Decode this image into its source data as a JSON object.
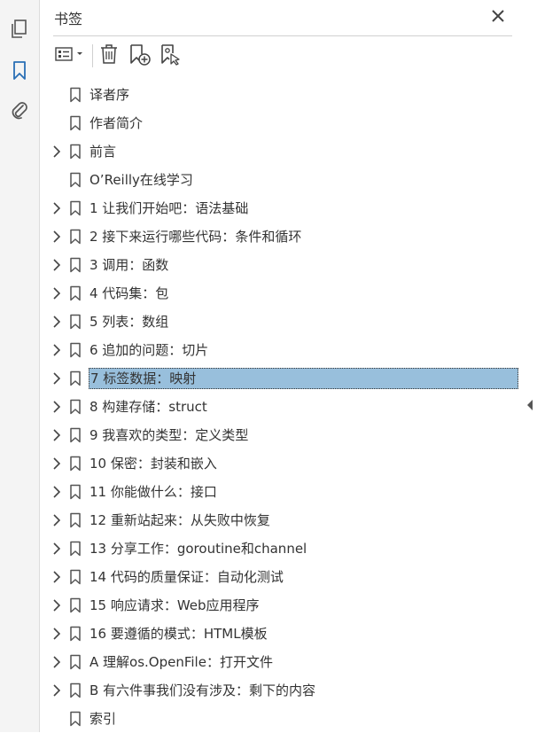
{
  "panel": {
    "title": "书签"
  },
  "rail": {
    "icons": [
      "pages-icon",
      "bookmark-icon",
      "attachment-icon"
    ]
  },
  "toolbar": {
    "icons": [
      "options-menu-icon",
      "delete-icon",
      "new-bookmark-icon",
      "bookmark-from-selection-icon"
    ]
  },
  "bookmarks": [
    {
      "label": "译者序",
      "expandable": false,
      "selected": false
    },
    {
      "label": "作者简介",
      "expandable": false,
      "selected": false
    },
    {
      "label": "前言",
      "expandable": true,
      "selected": false
    },
    {
      "label": "O’Reilly在线学习",
      "expandable": false,
      "selected": false
    },
    {
      "label": "1 让我们开始吧：语法基础",
      "expandable": true,
      "selected": false
    },
    {
      "label": "2 接下来运行哪些代码：条件和循环",
      "expandable": true,
      "selected": false
    },
    {
      "label": "3 调用：函数",
      "expandable": true,
      "selected": false
    },
    {
      "label": "4 代码集：包",
      "expandable": true,
      "selected": false
    },
    {
      "label": "5 列表：数组",
      "expandable": true,
      "selected": false
    },
    {
      "label": "6 追加的问题：切片",
      "expandable": true,
      "selected": false
    },
    {
      "label": "7 标签数据：映射",
      "expandable": true,
      "selected": true
    },
    {
      "label": "8 构建存储：struct",
      "expandable": true,
      "selected": false
    },
    {
      "label": "9 我喜欢的类型：定义类型",
      "expandable": true,
      "selected": false
    },
    {
      "label": "10 保密：封装和嵌入",
      "expandable": true,
      "selected": false
    },
    {
      "label": "11 你能做什么：接口",
      "expandable": true,
      "selected": false
    },
    {
      "label": "12 重新站起来：从失败中恢复",
      "expandable": true,
      "selected": false
    },
    {
      "label": "13 分享工作：goroutine和channel",
      "expandable": true,
      "selected": false
    },
    {
      "label": "14 代码的质量保证：自动化测试",
      "expandable": true,
      "selected": false
    },
    {
      "label": "15 响应请求：Web应用程序",
      "expandable": true,
      "selected": false
    },
    {
      "label": "16 要遵循的模式：HTML模板",
      "expandable": true,
      "selected": false
    },
    {
      "label": "A 理解os.OpenFile：打开文件",
      "expandable": true,
      "selected": false
    },
    {
      "label": "B 有六件事我们没有涉及：剩下的内容",
      "expandable": true,
      "selected": false
    },
    {
      "label": "索引",
      "expandable": false,
      "selected": false
    }
  ],
  "colors": {
    "accent": "#2a6fb5",
    "selection": "#98bfdc"
  }
}
